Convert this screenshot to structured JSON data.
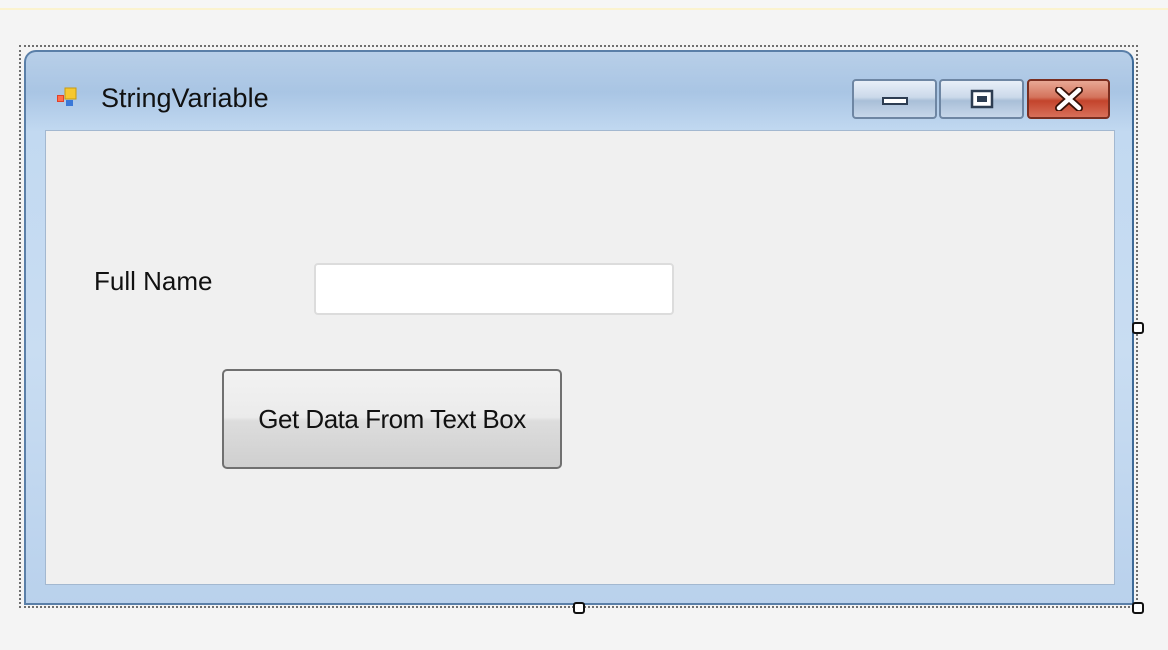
{
  "window": {
    "title": "StringVariable",
    "icon": "windows-form-icon"
  },
  "caption_buttons": {
    "minimize_icon": "minimize-icon",
    "maximize_icon": "maximize-icon",
    "close_icon": "close-icon"
  },
  "form": {
    "full_name_label": "Full Name",
    "full_name_value": "",
    "button_label": "Get Data From Text Box"
  },
  "colors": {
    "titlebar": "#b8cfe8",
    "client_background": "#f0f0f0",
    "close_button": "#c3442c"
  }
}
